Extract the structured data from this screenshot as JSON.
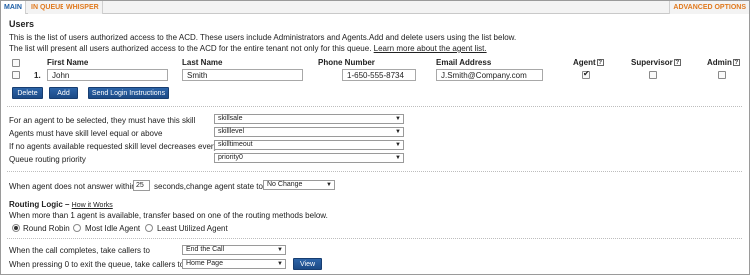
{
  "tabs": [
    {
      "label": "MAIN",
      "active": true
    },
    {
      "label": "IN QUEUE",
      "active": false
    },
    {
      "label": "WHISPER",
      "active": false
    }
  ],
  "advanced_options": "ADVANCED OPTIONS",
  "users": {
    "heading": "Users",
    "desc_line1": "This is the list of users authorized access to the ACD. These users include Administrators and Agents.Add and delete users using the list below.",
    "desc_line2": "The list will present all users authorized access to the ACD for the entire tenant not only for this queue.",
    "learn_more": "Learn more about the agent list.",
    "columns": {
      "first_name": "First Name",
      "last_name": "Last Name",
      "phone": "Phone Number",
      "email": "Email Address",
      "agent": "Agent",
      "supervisor": "Supervisor",
      "admin": "Admin"
    },
    "rows": [
      {
        "index": "1.",
        "first_name": "John",
        "last_name": "Smith",
        "phone": "1-650-555-8734",
        "email": "J.Smith@Company.com",
        "agent": true,
        "supervisor": false,
        "admin": false
      }
    ],
    "buttons": {
      "delete": "Delete",
      "add": "Add",
      "send_login": "Send Login Instructions"
    }
  },
  "skills": {
    "required_label": "For an agent to be selected, they must have this skill",
    "required_value": "skillsale",
    "level_label": "Agents must have skill level equal or above",
    "level_value": "skilllevel",
    "decrease_label": "If no agents available requested skill level decreases every",
    "decrease_value": "skilltimeout",
    "priority_label": "Queue routing priority",
    "priority_value": "priority0"
  },
  "no_answer": {
    "prefix": "When agent does not answer within",
    "seconds": "25",
    "suffix": "seconds,change agent state to",
    "state_value": "No Change"
  },
  "routing": {
    "title": "Routing Logic –",
    "how_it_works": "How it Works",
    "desc": "When more than 1 agent is available, transfer based on one of the routing methods below.",
    "options": [
      {
        "label": "Round Robin",
        "selected": true
      },
      {
        "label": "Most Idle Agent",
        "selected": false
      },
      {
        "label": "Least Utilized Agent",
        "selected": false
      }
    ]
  },
  "completion": {
    "complete_label": "When the call completes, take callers to",
    "complete_value": "End the Call",
    "exit_label": "When pressing 0 to exit the queue, take callers to",
    "exit_value": "Home Page",
    "view_button": "View"
  },
  "colors": {
    "tab_active": "#1f5fa6",
    "tab_inactive": "#e07a1f",
    "button_blue": "#1c4a86"
  }
}
